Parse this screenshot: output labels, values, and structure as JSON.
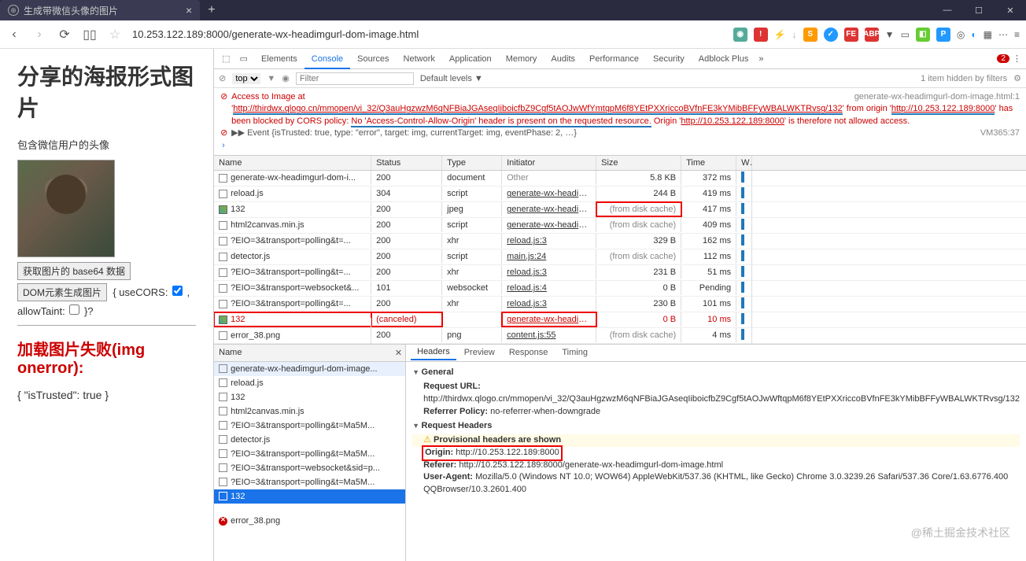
{
  "window": {
    "tab_title": "生成带微信头像的图片",
    "url": "10.253.122.189:8000/generate-wx-headimgurl-dom-image.html"
  },
  "page": {
    "h1": "分享的海报形式图片",
    "subtitle": "包含微信用户的头像",
    "btn_base64": "获取图片的 base64 数据",
    "btn_dom": "DOM元素生成图片",
    "opts_pre": "{ useCORS: ",
    "opts_mid": ", allowTaint: ",
    "opts_post": " }?",
    "error_heading": "加载图片失败(img onerror):",
    "json_text": "{ \"isTrusted\": true }"
  },
  "devtools": {
    "tabs": [
      "Elements",
      "Console",
      "Sources",
      "Network",
      "Application",
      "Memory",
      "Audits",
      "Performance",
      "Security",
      "Adblock Plus"
    ],
    "active_tab": "Console",
    "error_count": "2",
    "filter": {
      "context": "top",
      "placeholder": "Filter",
      "levels": "Default levels ▼",
      "hidden": "1 item hidden by filters"
    },
    "console": {
      "msg1_a": "Access to Image at '",
      "msg1_url": "http://thirdwx.qlogo.cn/mmopen/vi_32/Q3auHgzwzM6qNFBiaJGAseqIiboicfbZ9Cgf5tAOJwWfYmtqpM6f8YEtPXXriccoBVfnFE3kYMibBFFyWBALWKTRvsg/132",
      "msg1_b": "' from origin '",
      "msg1_origin": "http://10.253.122.189:8000",
      "msg1_c": "' has been blocked by CORS policy: ",
      "msg1_cors": "No 'Access-Control-Allow-Origin' header is present on the requested resource.",
      "msg1_d": " Origin '",
      "msg1_origin2": "http://10.253.122.189:8000",
      "msg1_e": "' is therefore not allowed access.",
      "msg1_src": "generate-wx-headimgurl-dom-image.html:1",
      "event": "▶▶ Event {isTrusted: true, type: \"error\", target: img, currentTarget: img, eventPhase: 2, …}",
      "event_src": "VM365:37",
      "prompt": "›"
    },
    "net": {
      "headers": [
        "Name",
        "Status",
        "Type",
        "Initiator",
        "Size",
        "Time",
        "W"
      ],
      "rows": [
        {
          "name": "generate-wx-headimgurl-dom-i...",
          "status": "200",
          "type": "document",
          "init": "Other",
          "init_gray": true,
          "size": "5.8 KB",
          "time": "372 ms",
          "ic": "doc"
        },
        {
          "name": "reload.js",
          "status": "304",
          "type": "script",
          "init": "generate-wx-headim...",
          "size": "244 B",
          "time": "419 ms",
          "ic": "js"
        },
        {
          "name": "132",
          "status": "200",
          "type": "jpeg",
          "init": "generate-wx-headim...",
          "size": "(from disk cache)",
          "size_hl": true,
          "time": "417 ms",
          "ic": "img"
        },
        {
          "name": "html2canvas.min.js",
          "status": "200",
          "type": "script",
          "init": "generate-wx-headim...",
          "size": "(from disk cache)",
          "time": "409 ms",
          "ic": "js"
        },
        {
          "name": "?EIO=3&transport=polling&t=...",
          "status": "200",
          "type": "xhr",
          "init": "reload.js:3",
          "size": "329 B",
          "time": "162 ms",
          "ic": "js"
        },
        {
          "name": "detector.js",
          "status": "200",
          "type": "script",
          "init": "main.js:24",
          "size": "(from disk cache)",
          "time": "112 ms",
          "ic": "js"
        },
        {
          "name": "?EIO=3&transport=polling&t=...",
          "status": "200",
          "type": "xhr",
          "init": "reload.js:3",
          "size": "231 B",
          "time": "51 ms",
          "ic": "js"
        },
        {
          "name": "?EIO=3&transport=websocket&...",
          "status": "101",
          "type": "websocket",
          "init": "reload.js:4",
          "size": "0 B",
          "time": "Pending",
          "ic": "js"
        },
        {
          "name": "?EIO=3&transport=polling&t=...",
          "status": "200",
          "type": "xhr",
          "init": "reload.js:3",
          "size": "230 B",
          "time": "101 ms",
          "ic": "js"
        },
        {
          "name": "132",
          "status": "(canceled)",
          "type": "",
          "init": "generate-wx-headim...",
          "size": "0 B",
          "time": "10 ms",
          "ic": "img",
          "red": true,
          "row_hl": true
        },
        {
          "name": "error_38.png",
          "status": "200",
          "type": "png",
          "init": "content.js:55",
          "size": "(from disk cache)",
          "time": "4 ms",
          "ic": "err"
        }
      ]
    },
    "lower": {
      "left_header": "Name",
      "items": [
        {
          "name": "generate-wx-headimgurl-dom-image...",
          "ic": "doc",
          "sel": true
        },
        {
          "name": "reload.js",
          "ic": "js"
        },
        {
          "name": "132",
          "ic": "img"
        },
        {
          "name": "html2canvas.min.js",
          "ic": "js"
        },
        {
          "name": "?EIO=3&transport=polling&t=Ma5M...",
          "ic": "js"
        },
        {
          "name": "detector.js",
          "ic": "js"
        },
        {
          "name": "?EIO=3&transport=polling&t=Ma5M...",
          "ic": "js"
        },
        {
          "name": "?EIO=3&transport=websocket&sid=p...",
          "ic": "js"
        },
        {
          "name": "?EIO=3&transport=polling&t=Ma5M...",
          "ic": "js"
        },
        {
          "name": "132",
          "ic": "img",
          "sel2": true
        },
        {
          "name": "error_38.png",
          "ic": "err"
        }
      ],
      "req_tabs": [
        "Headers",
        "Preview",
        "Response",
        "Timing"
      ],
      "general": "General",
      "req_url_k": "Request URL:",
      "req_url_v": "http://thirdwx.qlogo.cn/mmopen/vi_32/Q3auHgzwzM6qNFBiaJGAseqIiboicfbZ9Cgf5tAOJwWftqpM6f8YEtPXXriccoBVfnFE3kYMibBFFyWBALWKTRvsg/132",
      "ref_pol_k": "Referrer Policy:",
      "ref_pol_v": "no-referrer-when-downgrade",
      "req_headers": "Request Headers",
      "prov": "Provisional headers are shown",
      "origin_k": "Origin:",
      "origin_v": "http://10.253.122.189:8000",
      "referer_k": "Referer:",
      "referer_v": "http://10.253.122.189:8000/generate-wx-headimgurl-dom-image.html",
      "ua_k": "User-Agent:",
      "ua_v": "Mozilla/5.0 (Windows NT 10.0; WOW64) AppleWebKit/537.36 (KHTML, like Gecko) Chrome 3.0.3239.26 Safari/537.36 Core/1.63.6776.400 QQBrowser/10.3.2601.400"
    }
  },
  "watermark": "@稀土掘金技术社区"
}
